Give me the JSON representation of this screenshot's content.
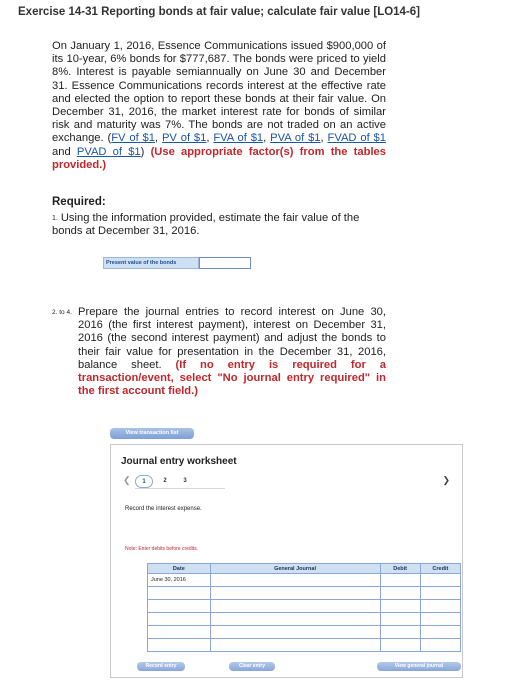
{
  "exercise_title": "Exercise 14-31 Reporting bonds at fair value; calculate fair value [LO14-6]",
  "problem": {
    "text": "On January 1, 2016, Essence Communications issued $900,000 of its 10-year, 6% bonds for $777,687. The bonds were priced to yield 8%. Interest is payable semiannually on June 30 and December 31. Essence Communications records interest at the effective rate and elected the option to report these bonds at their fair value. On December 31, 2016, the market interest rate for bonds of similar risk and maturity was 7%. The bonds are not traded on an active exchange. (",
    "links": [
      "FV of $1",
      "PV of $1",
      "FVA of $1",
      "PVA of $1",
      "FVAD of $1",
      "PVAD of $1"
    ],
    "separator": ", ",
    "and": " and ",
    "close": ") ",
    "instruction": "(Use appropriate factor(s) from the tables provided.)"
  },
  "required": {
    "heading": "Required:",
    "req1_num": "1.",
    "req1_text": "Using the information provided, estimate the fair value of the bonds at December 31, 2016.",
    "pv_label": "Present value of the bonds",
    "pv_value": "",
    "req2_num": "2. to 4.",
    "req2_text": "Prepare the journal entries to record interest on June 30, 2016 (the first interest payment), interest on December 31, 2016 (the second interest payment) and adjust the bonds to their fair value for presentation in the December 31, 2016, balance sheet. ",
    "req2_instruction": "(If no entry is required for a transaction/event, select \"No journal entry required\" in the first account field.)"
  },
  "view_transaction_label": "View transaction list",
  "worksheet": {
    "title": "Journal entry worksheet",
    "steps": [
      "1",
      "2",
      "3"
    ],
    "instruction": "Record the interest expense.",
    "note": "Note: Enter debits before credits.",
    "columns": [
      "Date",
      "General Journal",
      "Debit",
      "Credit"
    ],
    "rows": [
      {
        "date": "June 30, 2016"
      },
      {
        "date": ""
      },
      {
        "date": ""
      },
      {
        "date": ""
      },
      {
        "date": ""
      },
      {
        "date": ""
      }
    ],
    "buttons": {
      "record": "Record entry",
      "clear": "Clear entry",
      "view": "View general journal"
    }
  }
}
